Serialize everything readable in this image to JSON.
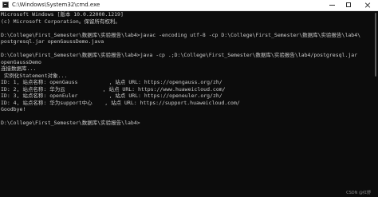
{
  "window": {
    "title": "C:\\Windows\\System32\\cmd.exe",
    "icon": "terminal-icon",
    "controls": {
      "minimize_icon": "minimize-icon",
      "maximize_icon": "maximize-icon",
      "close_icon": "close-icon"
    }
  },
  "console": {
    "lines": [
      "Microsoft Windows [版本 10.0.22000.1219]",
      "(c) Microsoft Corporation。保留所有权利。",
      "",
      "D:\\College\\First_Semester\\数据库\\实验报告\\lab4>javac -encoding utf-8 -cp D:\\College\\First_Semester\\数据库\\实验报告\\lab4\\",
      "postgresql.jar openGaussDemo.java",
      "",
      "D:\\College\\First_Semester\\数据库\\实验报告\\lab4>java -cp .;D:\\College\\First_Semester\\数据库\\实验报告\\lab4/postgresql.jar",
      "openGaussDemo",
      "连接数据库...",
      " 实例化Statement对象...",
      "ID: 1, 站点名称: openGauss          , 站点 URL: https://opengauss.org/zh/",
      "ID: 2, 站点名称: 华为云            , 站点 URL: https://www.huaweicloud.com/",
      "ID: 3, 站点名称: openEuler          , 站点 URL: https://openeuler.org/zh/",
      "ID: 4, 站点名称: 华为support中心    , 站点 URL: https://support.huaweicloud.com/",
      "Goodbye!",
      "",
      "D:\\College\\First_Semester\\数据库\\实验报告\\lab4>"
    ]
  },
  "colors": {
    "console_background": "#0c0c0c",
    "console_text": "#cccccc",
    "titlebar_background": "#ffffff"
  },
  "watermark": {
    "text": "CSDN @红野"
  }
}
